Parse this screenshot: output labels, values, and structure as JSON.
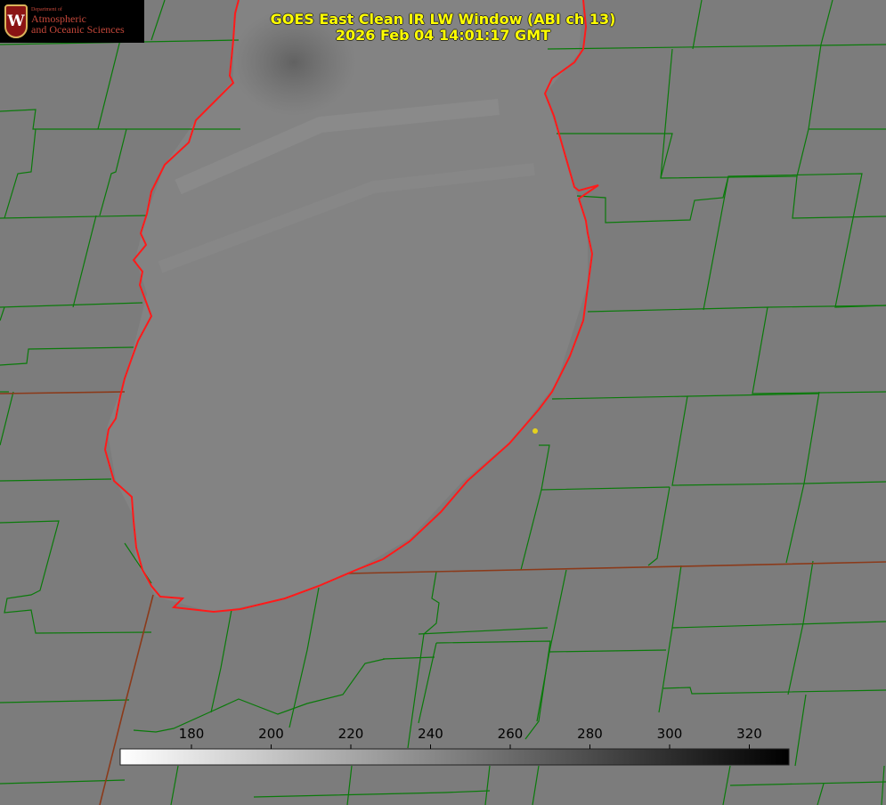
{
  "title": {
    "line1": "GOES East Clean IR LW Window (ABI ch 13)",
    "line2": "2026 Feb 04 14:01:17 GMT"
  },
  "logo": {
    "department": "Department of",
    "line1": "Atmospheric",
    "line2": "and Oceanic Sciences",
    "crest_letter": "W"
  },
  "colorbar": {
    "ticks": [
      "180",
      "200",
      "220",
      "240",
      "260",
      "280",
      "300",
      "320"
    ],
    "gradient_from": "#ffffff",
    "gradient_to": "#000000"
  },
  "colors": {
    "background": "#7c7c7c",
    "lake": "#838383",
    "county_lines": "#0a7a0a",
    "state_lines": "#8b3a1a",
    "lake_outline": "#ff1a1a",
    "marker": "#e6d21e"
  }
}
